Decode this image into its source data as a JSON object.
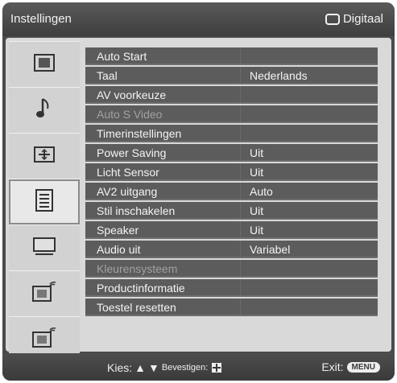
{
  "header": {
    "title": "Instellingen",
    "mode": "Digitaal",
    "mode_icon": "tv-icon"
  },
  "sidebar": {
    "items": [
      {
        "icon": "picture-icon",
        "active": false
      },
      {
        "icon": "music-note-icon",
        "active": false
      },
      {
        "icon": "screen-adjust-icon",
        "active": false
      },
      {
        "icon": "settings-list-icon",
        "active": true
      },
      {
        "icon": "pc-monitor-icon",
        "active": false
      },
      {
        "icon": "input-a-icon",
        "active": false
      },
      {
        "icon": "input-b-icon",
        "active": false
      }
    ]
  },
  "menu": {
    "rows": [
      {
        "label": "Auto Start",
        "value": "",
        "enabled": true
      },
      {
        "label": "Taal",
        "value": "Nederlands",
        "enabled": true
      },
      {
        "label": "AV voorkeuze",
        "value": "",
        "enabled": true
      },
      {
        "label": "Auto S Video",
        "value": "",
        "enabled": false
      },
      {
        "label": "Timerinstellingen",
        "value": "",
        "enabled": true
      },
      {
        "label": "Power Saving",
        "value": "Uit",
        "enabled": true
      },
      {
        "label": "Licht Sensor",
        "value": "Uit",
        "enabled": true
      },
      {
        "label": "AV2 uitgang",
        "value": "Auto",
        "enabled": true
      },
      {
        "label": "Stil inschakelen",
        "value": "Uit",
        "enabled": true
      },
      {
        "label": "Speaker",
        "value": "Uit",
        "enabled": true
      },
      {
        "label": "Audio uit",
        "value": "Variabel",
        "enabled": true
      },
      {
        "label": "Kleurensysteem",
        "value": "",
        "enabled": false
      },
      {
        "label": "Productinformatie",
        "value": "",
        "enabled": true
      },
      {
        "label": "Toestel resetten",
        "value": "",
        "enabled": true
      }
    ]
  },
  "footer": {
    "select_label": "Kies:",
    "confirm_label": "Bevestigen:",
    "exit_label": "Exit:",
    "menu_button": "MENU"
  }
}
